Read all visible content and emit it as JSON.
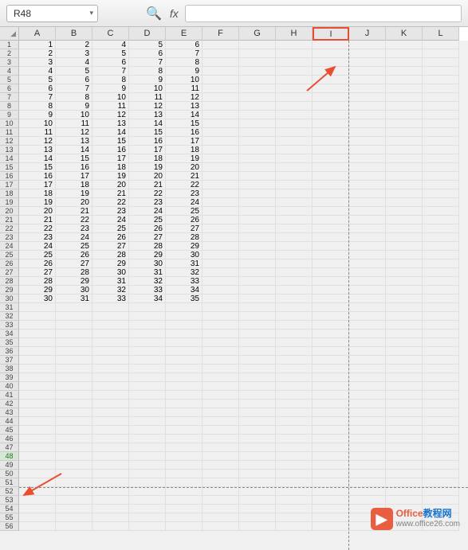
{
  "toolbar": {
    "name_box": "R48",
    "fx_label": "fx"
  },
  "columns": [
    "A",
    "B",
    "C",
    "D",
    "E",
    "F",
    "G",
    "H",
    "I",
    "J",
    "K",
    "L"
  ],
  "highlight_col_index": 8,
  "active_row": 48,
  "num_rows": 56,
  "data_rows": [
    [
      1,
      2,
      4,
      5,
      6
    ],
    [
      2,
      3,
      5,
      6,
      7
    ],
    [
      3,
      4,
      6,
      7,
      8
    ],
    [
      4,
      5,
      7,
      8,
      9
    ],
    [
      5,
      6,
      8,
      9,
      10
    ],
    [
      6,
      7,
      9,
      10,
      11
    ],
    [
      7,
      8,
      10,
      11,
      12
    ],
    [
      8,
      9,
      11,
      12,
      13
    ],
    [
      9,
      10,
      12,
      13,
      14
    ],
    [
      10,
      11,
      13,
      14,
      15
    ],
    [
      11,
      12,
      14,
      15,
      16
    ],
    [
      12,
      13,
      15,
      16,
      17
    ],
    [
      13,
      14,
      16,
      17,
      18
    ],
    [
      14,
      15,
      17,
      18,
      19
    ],
    [
      15,
      16,
      18,
      19,
      20
    ],
    [
      16,
      17,
      19,
      20,
      21
    ],
    [
      17,
      18,
      20,
      21,
      22
    ],
    [
      18,
      19,
      21,
      22,
      23
    ],
    [
      19,
      20,
      22,
      23,
      24
    ],
    [
      20,
      21,
      23,
      24,
      25
    ],
    [
      21,
      22,
      24,
      25,
      26
    ],
    [
      22,
      23,
      25,
      26,
      27
    ],
    [
      23,
      24,
      26,
      27,
      28
    ],
    [
      24,
      25,
      27,
      28,
      29
    ],
    [
      25,
      26,
      28,
      29,
      30
    ],
    [
      26,
      27,
      29,
      30,
      31
    ],
    [
      27,
      28,
      30,
      31,
      32
    ],
    [
      28,
      29,
      31,
      32,
      33
    ],
    [
      29,
      30,
      32,
      33,
      34
    ],
    [
      30,
      31,
      33,
      34,
      35
    ]
  ],
  "watermark": {
    "brand1": "Office",
    "brand2": "教程网",
    "url": "www.office26.com"
  }
}
